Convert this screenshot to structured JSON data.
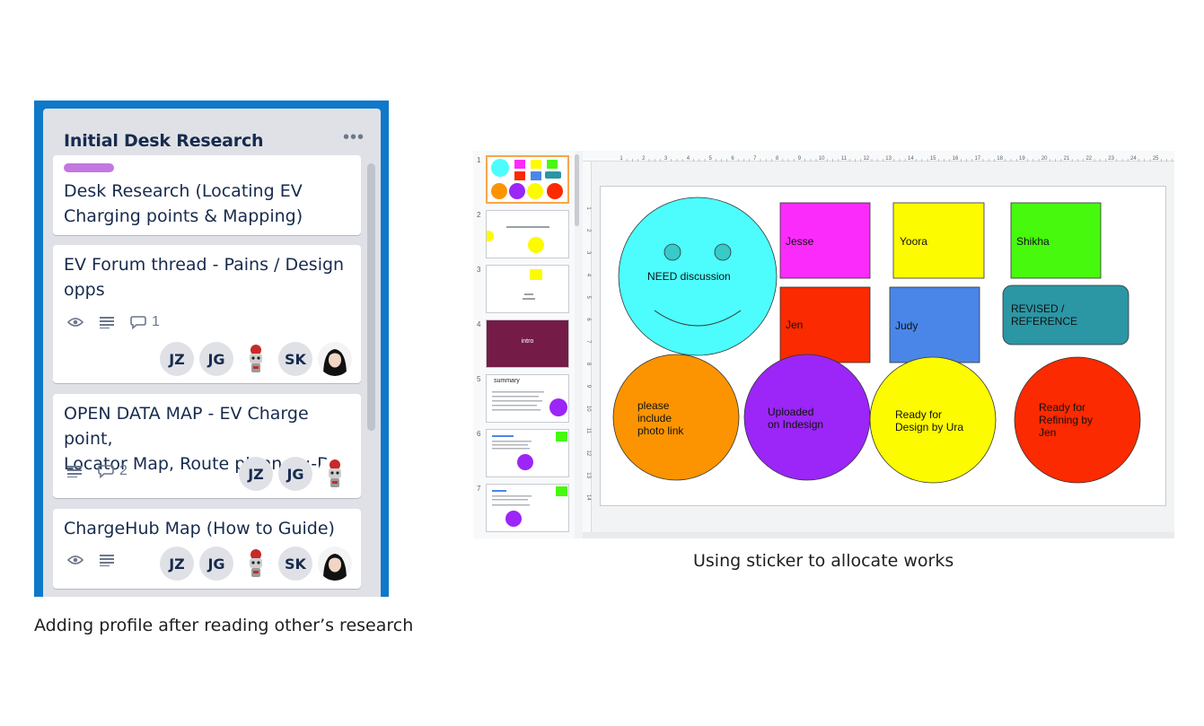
{
  "trello": {
    "list_title": "Initial Desk Research",
    "menu_icon": "ellipsis-icon",
    "cards": [
      {
        "label_color": "#c377e0",
        "title_line1": "Desk Research (Locating EV",
        "title_line2": "Charging points & Mapping)"
      },
      {
        "title_line1": "EV Forum thread - Pains / Design",
        "title_line2": "opps",
        "comment_count": "1",
        "members": [
          "JZ",
          "JG",
          "SK"
        ]
      },
      {
        "title_line1": "OPEN DATA MAP - EV Charge point,",
        "title_line2": "Locator Map, Route planner :-D",
        "comment_count": "2",
        "members": [
          "JZ",
          "JG"
        ]
      },
      {
        "title_line1": "ChargeHub Map (How to Guide)",
        "members": [
          "JZ",
          "JG",
          "SK"
        ]
      }
    ],
    "caption": "Adding profile after reading other’s research"
  },
  "slides": {
    "thumb_numbers": [
      "1",
      "2",
      "3",
      "4",
      "5",
      "6",
      "7"
    ],
    "thumb4_text": "intro",
    "thumb5_text": "summary",
    "ruler_numbers": [
      "1",
      "2",
      "3",
      "4",
      "5",
      "6",
      "7",
      "8",
      "9",
      "10",
      "11",
      "12",
      "13",
      "14",
      "15",
      "16",
      "17",
      "18",
      "19",
      "20",
      "21",
      "22",
      "23",
      "24",
      "25"
    ],
    "ruler_left_numbers": [
      "1",
      "2",
      "3",
      "4",
      "5",
      "6",
      "7",
      "8",
      "9",
      "10",
      "11",
      "12",
      "13",
      "14"
    ],
    "stickers": {
      "smiley": "NEED discussion",
      "jesse": "Jesse",
      "yoora": "Yoora",
      "shikha": "Shikha",
      "jen": "Jen",
      "judy": "Judy",
      "revised_l1": "REVISED /",
      "revised_l2": "REFERENCE",
      "orange_l1": "please",
      "orange_l2": "include",
      "orange_l3": "photo link",
      "purple_l1": "Uploaded",
      "purple_l2": "on Indesign",
      "yellow_l1": "Ready for",
      "yellow_l2": "Design by Ura",
      "red_l1": "Ready for",
      "red_l2": "Refining by",
      "red_l3": "Jen"
    },
    "colors": {
      "cyan": "#4dfdfd",
      "magenta": "#fb2cfb",
      "yellow": "#fcfb00",
      "green": "#47f90d",
      "red": "#fb2a00",
      "blue": "#4a86e8",
      "teal": "#2b96a4",
      "orange": "#fb9400",
      "purple": "#9b26f7"
    },
    "caption": "Using sticker to allocate works"
  }
}
